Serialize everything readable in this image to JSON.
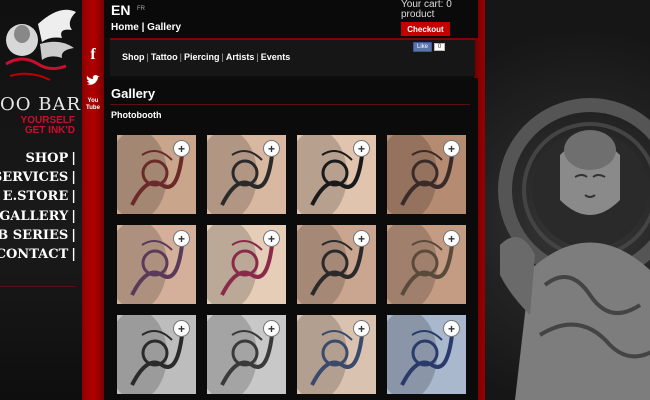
{
  "brand": {
    "name": "OO BAR",
    "tagline": [
      "YOURSELF",
      "GET INK'D"
    ]
  },
  "left_nav": [
    {
      "label": "SHOP"
    },
    {
      "label": "SERVICES"
    },
    {
      "label": "E.STORE"
    },
    {
      "label": "GALLERY"
    },
    {
      "label": "EB SERIES"
    },
    {
      "label": "CONTACT"
    }
  ],
  "left_nav_separator": "|",
  "social": [
    {
      "icon": "facebook-icon",
      "glyph": "f"
    },
    {
      "icon": "twitter-icon",
      "glyph": "t"
    },
    {
      "icon": "youtube-icon",
      "glyph": "You Tube"
    }
  ],
  "language": {
    "active": "EN",
    "other": "FR"
  },
  "breadcrumb": {
    "home": "Home",
    "separator": "|",
    "current": "Gallery"
  },
  "cart": {
    "text": "Your cart: 0 product",
    "checkout_label": "Checkout"
  },
  "facebook": {
    "like_label": "Like",
    "count": "0"
  },
  "menu": {
    "items": [
      "Shop",
      "Tattoo",
      "Piercing",
      "Artists",
      "Events"
    ],
    "separator": "|"
  },
  "page_title": "Gallery",
  "section_title": "Photobooth",
  "colors": {
    "accent_red": "#c40000",
    "strip_red": "#b40000",
    "background": "#0d0d0d"
  },
  "gallery": [
    {
      "name": "tattoo-photo-flowers-arm",
      "zoom_icon": "zoom-in-icon"
    },
    {
      "name": "tattoo-photo-feather-birds",
      "zoom_icon": "zoom-in-icon"
    },
    {
      "name": "tattoo-photo-silhouette-couple",
      "zoom_icon": "zoom-in-icon"
    },
    {
      "name": "tattoo-photo-tribal-mask",
      "zoom_icon": "zoom-in-icon"
    },
    {
      "name": "tattoo-photo-lotus",
      "zoom_icon": "zoom-in-icon"
    },
    {
      "name": "tattoo-photo-cherry-blossom",
      "zoom_icon": "zoom-in-icon"
    },
    {
      "name": "tattoo-photo-filigree-leg",
      "zoom_icon": "zoom-in-icon"
    },
    {
      "name": "tattoo-photo-anchor-roses",
      "zoom_icon": "zoom-in-icon"
    },
    {
      "name": "tattoo-photo-script-letter",
      "zoom_icon": "zoom-in-icon"
    },
    {
      "name": "tattoo-photo-rose",
      "zoom_icon": "zoom-in-icon"
    },
    {
      "name": "tattoo-photo-tea-cup",
      "zoom_icon": "zoom-in-icon"
    },
    {
      "name": "tattoo-photo-blue-angel",
      "zoom_icon": "zoom-in-icon"
    }
  ]
}
